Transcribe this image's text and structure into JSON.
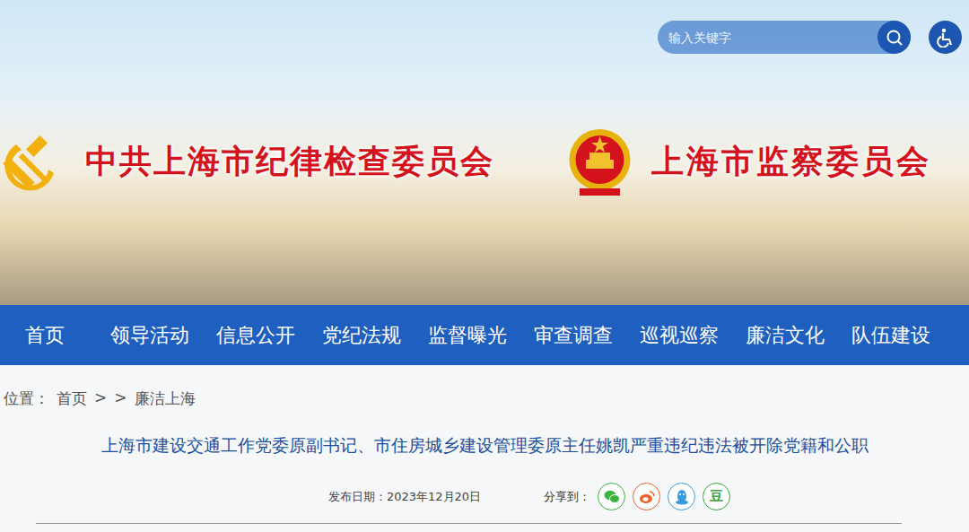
{
  "header": {
    "org_title": "中共上海市纪律检查委员会",
    "commission_title": "上海市监察委员会"
  },
  "search": {
    "placeholder": "输入关键字"
  },
  "nav": [
    {
      "label": "首页"
    },
    {
      "label": "领导活动"
    },
    {
      "label": "信息公开"
    },
    {
      "label": "党纪法规"
    },
    {
      "label": "监督曝光"
    },
    {
      "label": "审查调查"
    },
    {
      "label": "巡视巡察"
    },
    {
      "label": "廉洁文化"
    },
    {
      "label": "队伍建设"
    }
  ],
  "breadcrumb": {
    "label": "位置：",
    "items": [
      "首页",
      ">",
      ">",
      "廉洁上海"
    ]
  },
  "article": {
    "title": "上海市建设交通工作党委原副书记、市住房城乡建设管理委原主任姚凯严重违纪违法被开除党籍和公职",
    "date": "发布日期：2023年12月20日",
    "share_label": "分享到：",
    "share": [
      {
        "kind": "wechat",
        "color": "#3fb33f"
      },
      {
        "kind": "weibo",
        "color": "#e8622c"
      },
      {
        "kind": "qq",
        "color": "#3a9be0"
      },
      {
        "kind": "douban",
        "glyph": "豆",
        "color": "#3aa33a"
      }
    ]
  }
}
